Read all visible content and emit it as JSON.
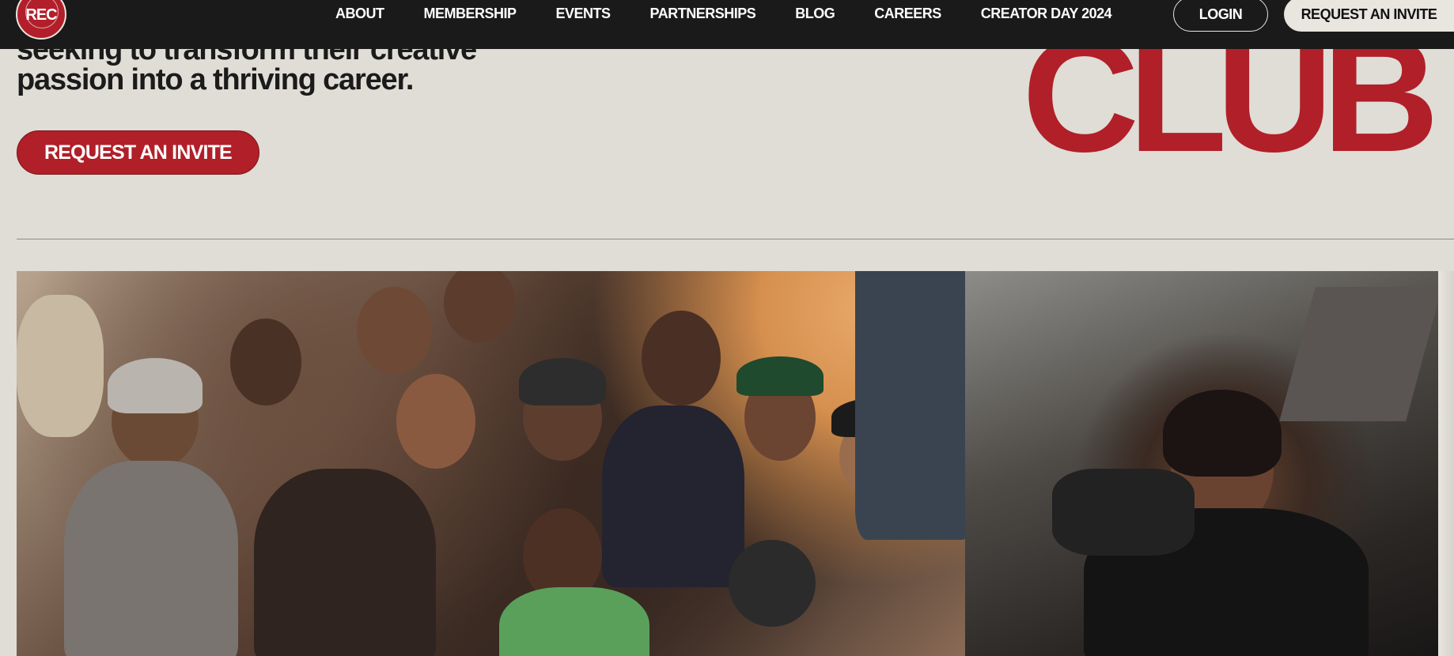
{
  "nav": {
    "logo_text": "REC",
    "links": [
      "ABOUT",
      "MEMBERSHIP",
      "EVENTS",
      "PARTNERSHIPS",
      "BLOG",
      "CAREERS",
      "CREATOR DAY 2024"
    ],
    "login_label": "LOGIN",
    "invite_label": "REQUEST AN INVITE"
  },
  "hero": {
    "tagline": "seeking to transform their creative passion into a thriving career.",
    "invite_button": "REQUEST AN INVITE",
    "big_word": "CLUB"
  },
  "colors": {
    "brand_red": "#b11f29",
    "background": "#dfddd5",
    "nav_bg": "#1a1a1a"
  },
  "photos": {
    "main": "crowd-photo",
    "side": "photographer-photo"
  }
}
